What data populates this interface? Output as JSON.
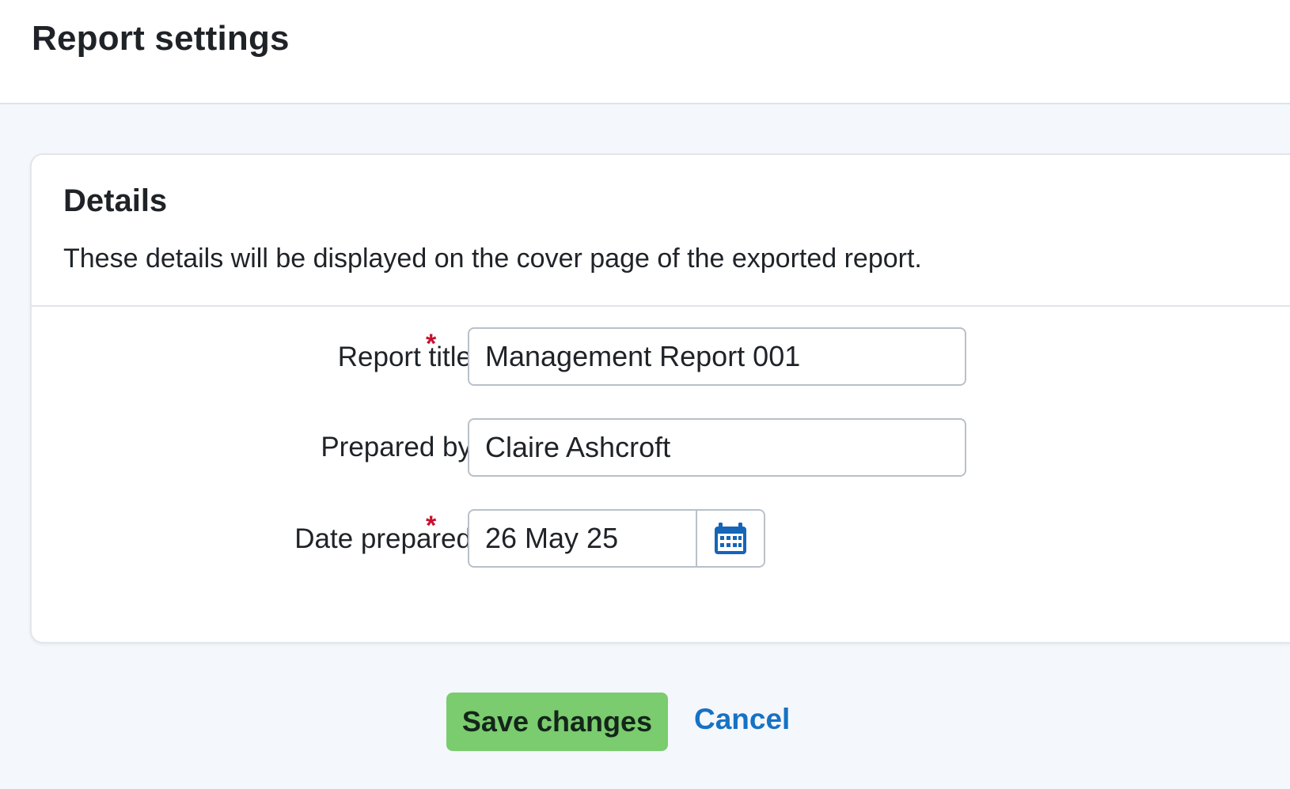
{
  "header": {
    "title": "Report settings"
  },
  "details": {
    "title": "Details",
    "description": "These details will be displayed on the cover page of the exported report."
  },
  "form": {
    "report_title": {
      "label": "Report title",
      "required_marker": "*",
      "value": "Management Report 001"
    },
    "prepared_by": {
      "label": "Prepared by",
      "value": "Claire Ashcroft"
    },
    "date_prepared": {
      "label": "Date prepared",
      "required_marker": "*",
      "value": "26 May 25",
      "icon": "calendar-icon"
    }
  },
  "actions": {
    "save_label": "Save changes",
    "cancel_label": "Cancel"
  },
  "colors": {
    "primary_button": "#7acc6e",
    "link": "#1672c4",
    "required": "#c8102e",
    "page_background": "#f4f7fc"
  }
}
